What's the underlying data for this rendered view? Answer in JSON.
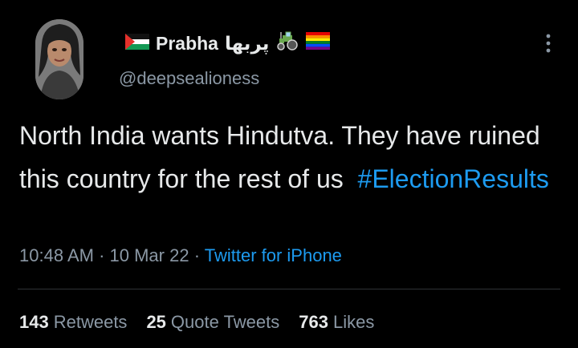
{
  "author": {
    "display_name": "Prabha",
    "display_name_urdu": "پربھا",
    "handle": "@deepsealioness",
    "badges": [
      "palestine-flag-icon",
      "tractor-icon",
      "rainbow-flag-icon"
    ]
  },
  "tweet": {
    "text_before": "North India wants Hindutva. They have ruined this country for the rest of us",
    "hashtag": "#ElectionResults"
  },
  "meta": {
    "time": "10:48 AM",
    "sep1": " · ",
    "date": "10 Mar 22",
    "sep2": " · ",
    "source": "Twitter for iPhone"
  },
  "stats": {
    "retweets_count": "143",
    "retweets_label": "Retweets",
    "quotes_count": "25",
    "quotes_label": "Quote Tweets",
    "likes_count": "763",
    "likes_label": "Likes"
  },
  "colors": {
    "background": "#000000",
    "text": "#e7e9ea",
    "secondary": "#8b98a5",
    "link": "#1d9bf0",
    "divider": "#2f3336"
  }
}
